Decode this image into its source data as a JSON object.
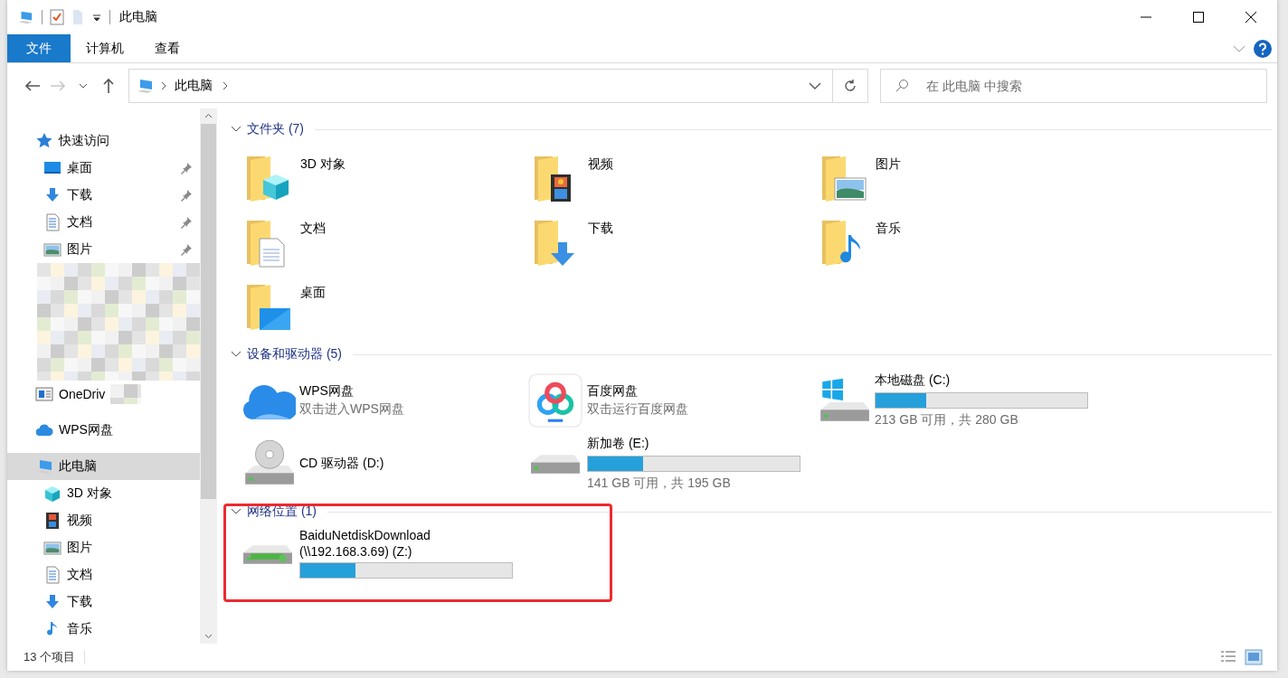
{
  "window": {
    "title": "此电脑"
  },
  "ribbon": {
    "tabs": [
      {
        "label": "文件",
        "kind": "file"
      },
      {
        "label": "计算机",
        "kind": "tab"
      },
      {
        "label": "查看",
        "kind": "tab"
      }
    ]
  },
  "navigation": {
    "back": {
      "disabled": false
    },
    "forward": {
      "disabled": true
    },
    "breadcrumb": [
      "此电脑"
    ],
    "search": {
      "placeholder": "在 此电脑 中搜索"
    }
  },
  "sidebar": {
    "items": [
      {
        "label": "快速访问",
        "kind": "star",
        "selected": false,
        "children": [
          {
            "label": "桌面",
            "kind": "desktop",
            "pinned": true,
            "selected": false
          },
          {
            "label": "下载",
            "kind": "download",
            "pinned": true,
            "selected": false
          },
          {
            "label": "文档",
            "kind": "document",
            "pinned": true,
            "selected": false
          },
          {
            "label": "图片",
            "kind": "pictures",
            "pinned": true,
            "selected": false
          }
        ]
      },
      {
        "label": "OneDriv",
        "kind": "onedrive",
        "selected": false
      },
      {
        "label": "WPS网盘",
        "kind": "cloud",
        "selected": false
      },
      {
        "label": "此电脑",
        "kind": "computer",
        "selected": true,
        "children": [
          {
            "label": "3D 对象",
            "kind": "cube",
            "selected": false
          },
          {
            "label": "视频",
            "kind": "video",
            "selected": false
          },
          {
            "label": "图片",
            "kind": "pictures",
            "selected": false
          },
          {
            "label": "文档",
            "kind": "document",
            "selected": false
          },
          {
            "label": "下载",
            "kind": "download",
            "selected": false
          },
          {
            "label": "音乐",
            "kind": "music",
            "selected": false
          }
        ]
      }
    ]
  },
  "folders": {
    "title": "文件夹 (7)",
    "items": [
      {
        "name": "3D 对象",
        "kind": "cube"
      },
      {
        "name": "视频",
        "kind": "video"
      },
      {
        "name": "图片",
        "kind": "pictures"
      },
      {
        "name": "文档",
        "kind": "document"
      },
      {
        "name": "下载",
        "kind": "download"
      },
      {
        "name": "音乐",
        "kind": "music"
      },
      {
        "name": "桌面",
        "kind": "desktop"
      }
    ]
  },
  "devices": {
    "title": "设备和驱动器 (5)",
    "items": [
      {
        "name": "WPS网盘",
        "kind": "wps",
        "subtitle": "双击进入WPS网盘"
      },
      {
        "name": "百度网盘",
        "kind": "baidu",
        "subtitle": "双击运行百度网盘"
      },
      {
        "name": "本地磁盘 (C:)",
        "kind": "system",
        "level": 0.24,
        "free": "213 GB 可用，共 280 GB"
      },
      {
        "name": "CD 驱动器 (D:)",
        "kind": "cd"
      },
      {
        "name": "新加卷 (E:)",
        "kind": "disk",
        "level": 0.26,
        "free": "141 GB 可用，共 195 GB"
      }
    ]
  },
  "network": {
    "title": "网络位置 (1)",
    "highlighted": true,
    "items": [
      {
        "name": "BaiduNetdiskDownload",
        "path": "(\\\\192.168.3.69) (Z:)",
        "kind": "network",
        "level": 0.26
      }
    ]
  },
  "status_bar": {
    "count": "13 个项目"
  }
}
